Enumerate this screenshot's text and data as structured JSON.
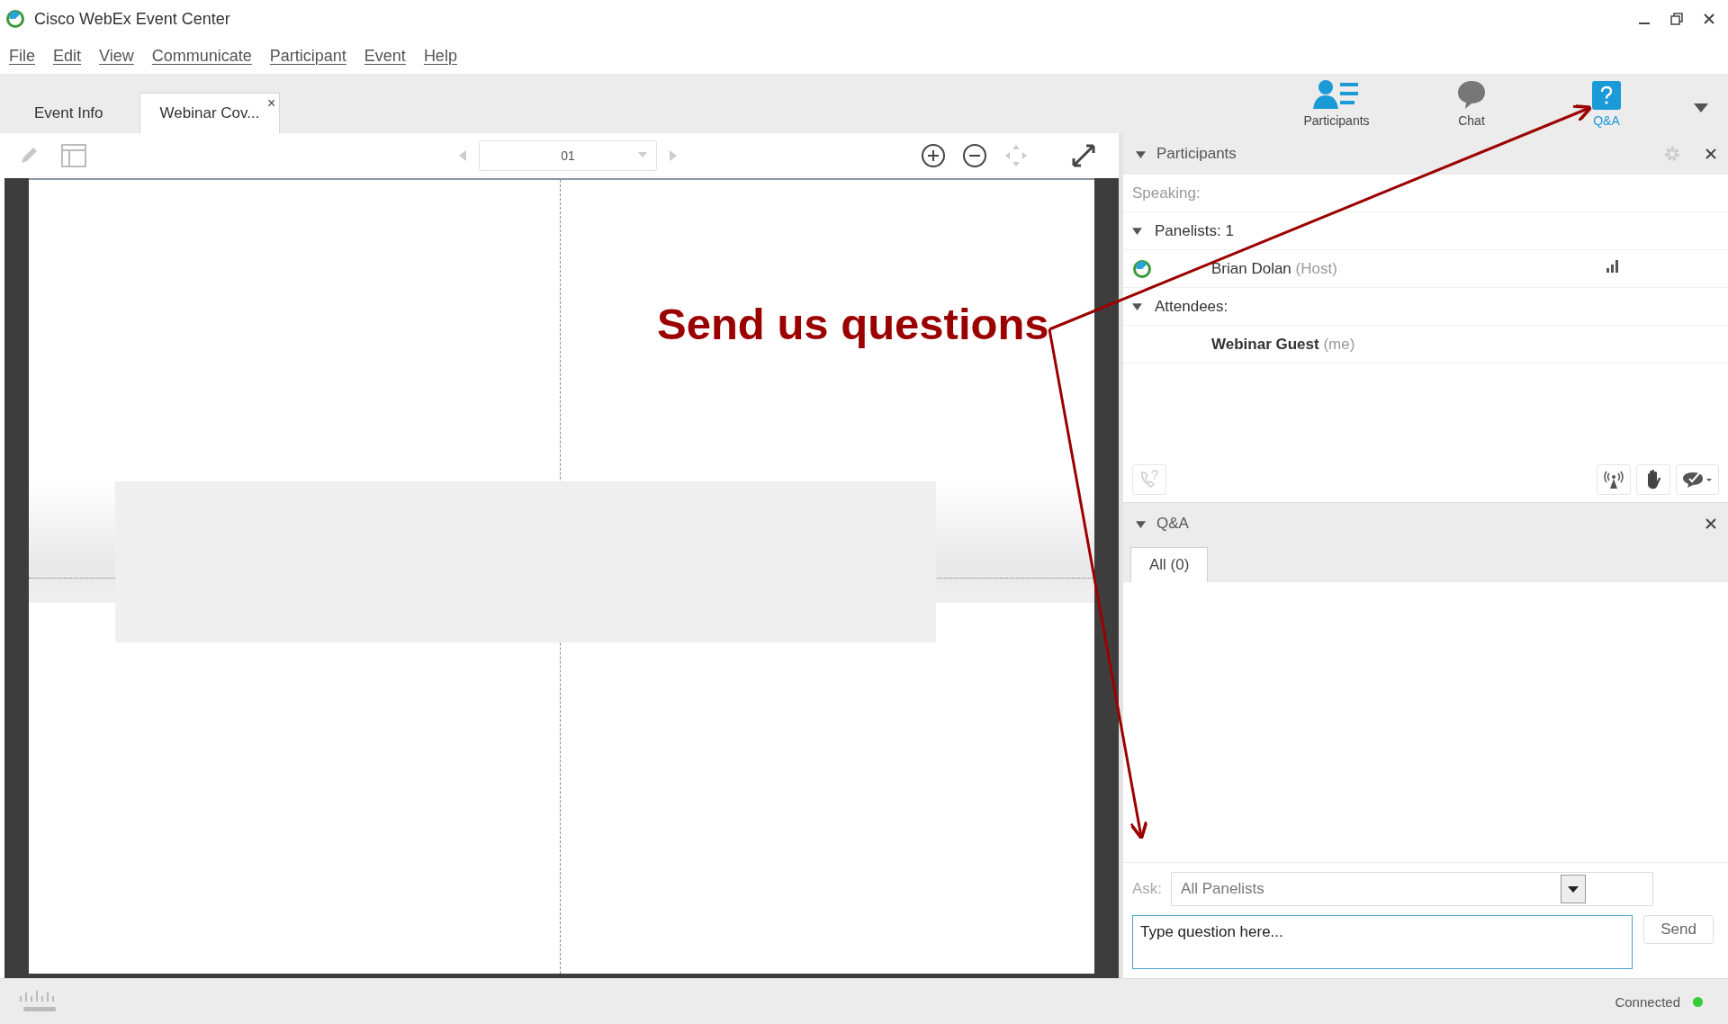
{
  "window": {
    "title": "Cisco WebEx Event Center"
  },
  "menu": [
    "File",
    "Edit",
    "View",
    "Communicate",
    "Participant",
    "Event",
    "Help"
  ],
  "tabs": [
    {
      "label": "Event Info",
      "selected": false,
      "closable": false
    },
    {
      "label": "Webinar Cov...",
      "selected": true,
      "closable": true
    }
  ],
  "close_glyph": "×",
  "panel_buttons": [
    {
      "label": "Participants",
      "kind": "participants",
      "selected": false
    },
    {
      "label": "Chat",
      "kind": "chat",
      "selected": false
    },
    {
      "label": "Q&A",
      "kind": "qa",
      "selected": true
    }
  ],
  "page_field": {
    "value": "01"
  },
  "participants": {
    "title": "Participants",
    "expanded": true,
    "speaking_label": "Speaking:",
    "groups": [
      {
        "label": "Panelists: 1",
        "expanded": true,
        "members": [
          {
            "name": "Brian Dolan",
            "role": "(Host)",
            "kind": "panelist",
            "self": false
          }
        ]
      },
      {
        "label": "Attendees:",
        "expanded": true,
        "members": [
          {
            "name": "Webinar Guest",
            "role": "(me)",
            "kind": "attendee",
            "self": true
          }
        ]
      }
    ]
  },
  "qa": {
    "title": "Q&A",
    "expanded": true,
    "tabs": [
      {
        "label": "All (0)",
        "selected": true
      }
    ],
    "ask_label": "Ask:",
    "ask_value": "All Panelists",
    "placeholder": "Type question here...",
    "send": "Send"
  },
  "status": {
    "text": "Connected",
    "color": "#33cc33"
  },
  "annotation": {
    "text": "Send us questions"
  }
}
